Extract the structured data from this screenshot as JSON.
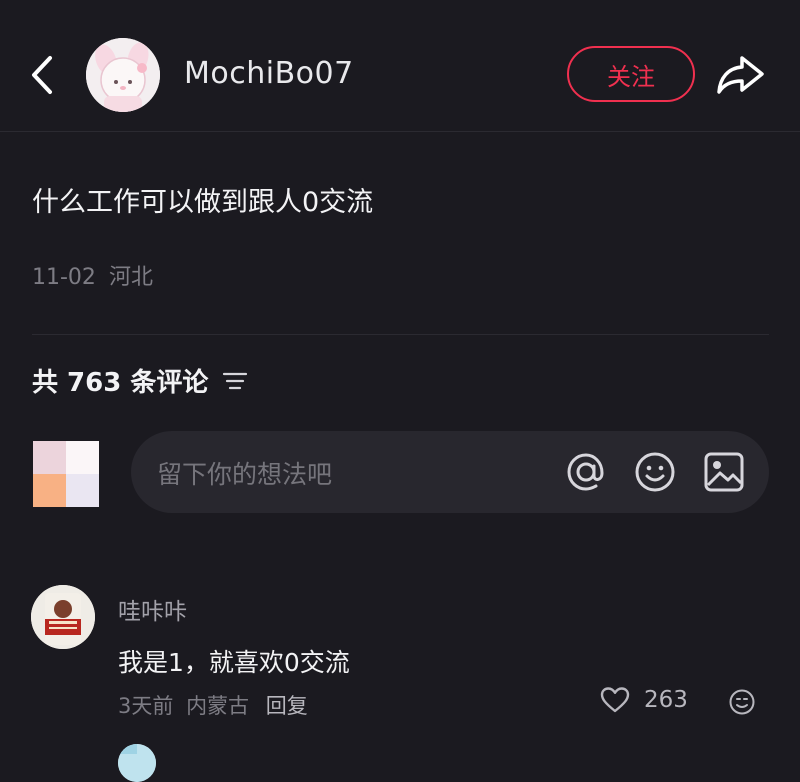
{
  "header": {
    "username": "MochiBo07",
    "follow_label": "关注",
    "back_icon": "chevron-left-icon",
    "share_icon": "share-arrow-icon"
  },
  "post": {
    "title": "什么工作可以做到跟人0交流",
    "date": "11-02",
    "location": "河北"
  },
  "comments_section": {
    "count_label": "共 763 条评论",
    "input_placeholder": "留下你的想法吧",
    "input_icons": [
      "at-icon",
      "emoji-icon",
      "image-icon"
    ]
  },
  "comments": [
    {
      "author": "哇咔咔",
      "text": "我是1，就喜欢0交流",
      "time": "3天前",
      "location": "内蒙古",
      "reply_label": "回复",
      "likes": "263"
    }
  ],
  "colors": {
    "background": "#1b1a20",
    "accent": "#f0304f",
    "input_bg": "#28272e"
  }
}
